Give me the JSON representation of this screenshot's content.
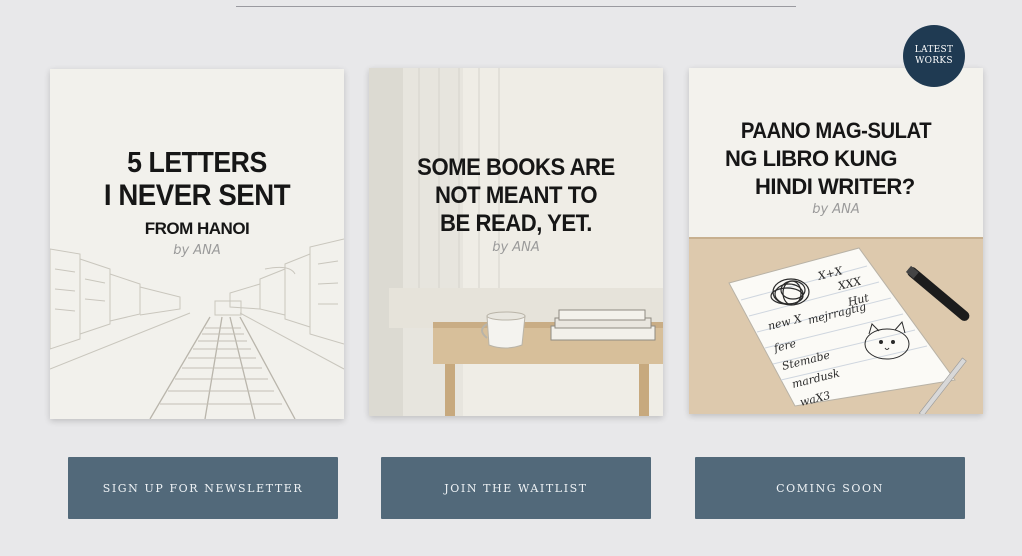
{
  "badge": {
    "line1": "LATEST",
    "line2": "WORKS"
  },
  "cards": [
    {
      "title_lines": [
        "5 LETTERS",
        "I NEVER SENT",
        "FROM HANOI"
      ],
      "byline": "by ANA",
      "illustration": "railway-street-sketch"
    },
    {
      "title_lines": [
        "SOME BOOKS ARE",
        "NOT MEANT TO",
        "BE READ, YET."
      ],
      "byline": "by ANA",
      "illustration": "window-table-cup-books"
    },
    {
      "title_lines": [
        "PAANO MAG-SULAT",
        "NG LIBRO KUNG",
        "HINDI WRITER?"
      ],
      "byline": "by ANA",
      "illustration": "desk-paper-pen-doodles",
      "doodle_words": [
        "X+X",
        "XXX",
        "Hut",
        "new X",
        "mejrragtig",
        "fere",
        "Stemabe",
        "mardusk",
        "waX3"
      ]
    }
  ],
  "buttons": [
    {
      "label": "SIGN UP FOR NEWSLETTER"
    },
    {
      "label": "JOIN THE WAITLIST"
    },
    {
      "label": "COMING SOON"
    }
  ],
  "colors": {
    "page_bg": "#e8e8ea",
    "button_bg": "#52697a",
    "badge_bg": "#1f3a52",
    "title_text": "#161616",
    "byline_text": "#9a9a9a"
  }
}
